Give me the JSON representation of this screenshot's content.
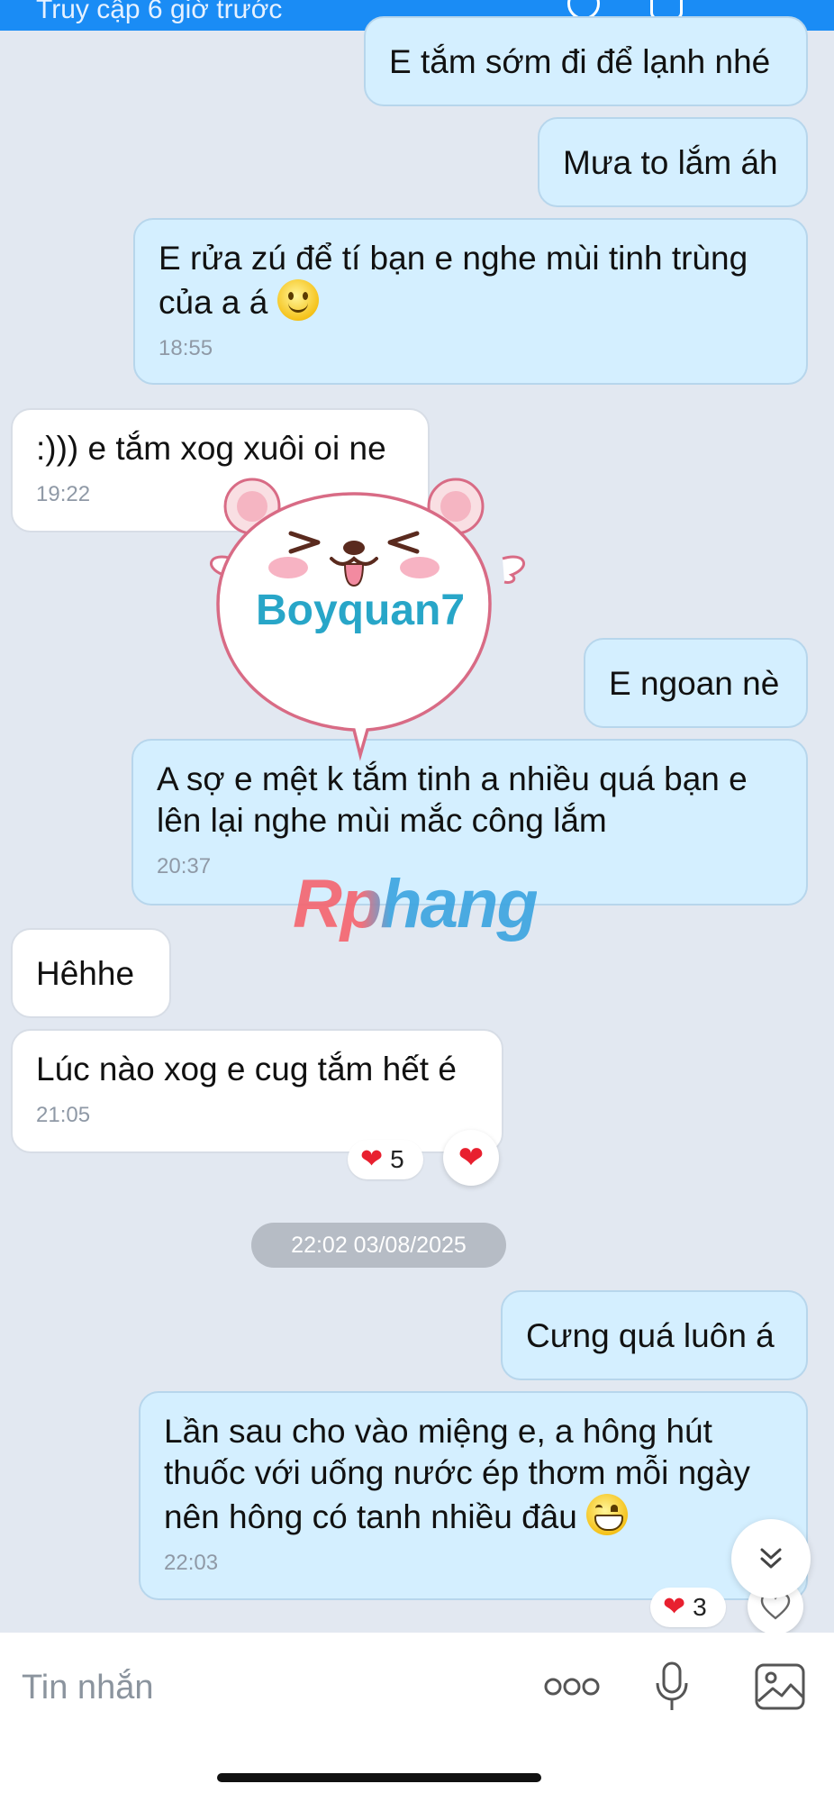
{
  "header": {
    "status": "Truy cập 6 giờ trước"
  },
  "messages": [
    {
      "id": "m1",
      "dir": "out",
      "text": "E tắm sớm đi để lạnh nhé",
      "time": ""
    },
    {
      "id": "m2",
      "dir": "out",
      "text": "Mưa to lắm áh",
      "time": ""
    },
    {
      "id": "m3",
      "dir": "out",
      "text": "E rửa zú để tí bạn e nghe mùi tinh trùng của a á",
      "time": "18:55",
      "emoji": "smiling-face"
    },
    {
      "id": "m4",
      "dir": "in",
      "text": ":))) e tắm xog xuôi oi ne",
      "time": "19:22"
    },
    {
      "id": "m5",
      "dir": "out",
      "text": "E ngoan nè",
      "time": ""
    },
    {
      "id": "m6",
      "dir": "out",
      "text": "A sợ e mệt k tắm tinh a nhiều quá bạn e lên lại nghe mùi mắc công lắm",
      "time": "20:37"
    },
    {
      "id": "m7",
      "dir": "in",
      "text": "Hêhhe",
      "time": ""
    },
    {
      "id": "m8",
      "dir": "in",
      "text": "Lúc nào xog e cug tắm hết é",
      "time": "21:05",
      "reaction_count": "5"
    },
    {
      "id": "m9",
      "dir": "out",
      "text": "Cưng quá luôn á",
      "time": ""
    },
    {
      "id": "m10",
      "dir": "out",
      "text": "Lần sau cho vào miệng e, a hông hút thuốc với uống nước ép thơm mỗi ngày nên hông có tanh nhiều đâu",
      "time": "22:03",
      "emoji": "grinning-face",
      "reaction_count": "3"
    }
  ],
  "date_separator": "22:02 03/08/2025",
  "watermarks": {
    "sticker_text": "Boyquan7",
    "brand_text": "Rphang"
  },
  "composer": {
    "placeholder": "Tin nhắn"
  },
  "colors": {
    "outgoing": "#d4efff",
    "incoming": "#ffffff",
    "background": "#e2e8f1",
    "header": "#1a8cf5",
    "heart": "#e8202f"
  },
  "icons": [
    "more-icon",
    "microphone-icon",
    "image-icon",
    "chevron-double-down-icon",
    "heart-icon",
    "heart-outline-icon"
  ]
}
